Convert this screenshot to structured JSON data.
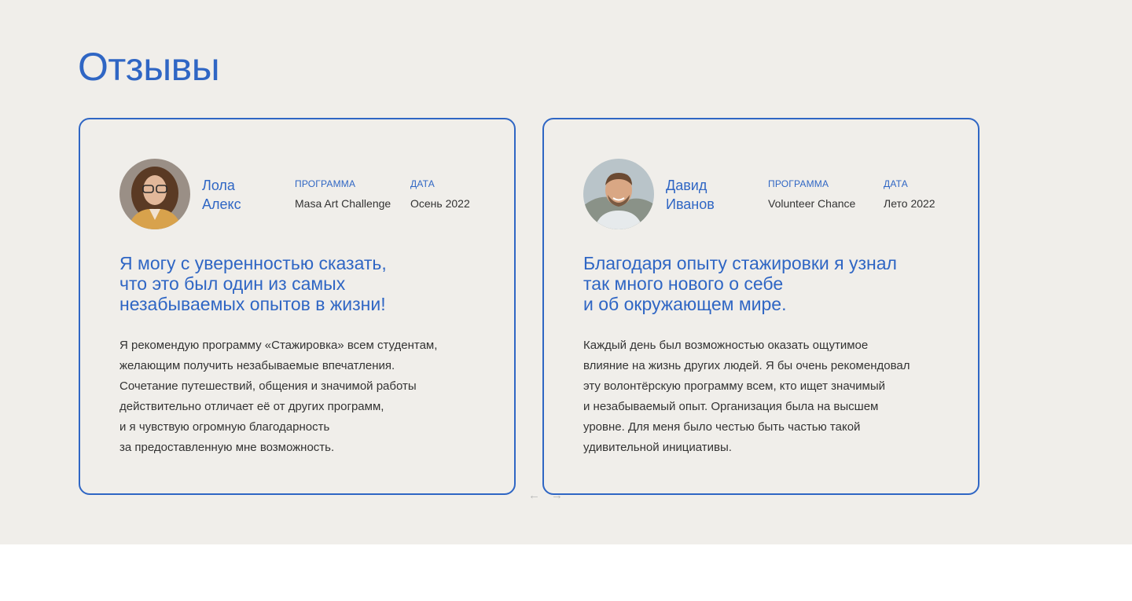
{
  "section": {
    "title": "Отзывы"
  },
  "labels": {
    "program": "ПРОГРАММА",
    "date": "ДАТА"
  },
  "reviews": [
    {
      "name": "Лола\nАлекс",
      "program": "Masa Art Challenge",
      "date": "Осень 2022",
      "quote": "Я могу с уверенностью сказать,\nчто это был один из самых\nнезабываемых опытов в жизни!",
      "text": "Я рекомендую программу «Стажировка» всем студентам,\nжелающим получить незабываемые впечатления.\nСочетание путешествий, общения и значимой работы\nдействительно отличает её от других программ,\nи я чувствую огромную благодарность\nза предоставленную мне возможность."
    },
    {
      "name": "Давид\nИванов",
      "program": "Volunteer Chance",
      "date": "Лето 2022",
      "quote": "Благодаря опыту стажировки я узнал\nтак много нового о себе\nи об окружающем мире.",
      "text": "Каждый день был возможностью оказать ощутимое\nвлияние на жизнь других людей. Я бы очень рекомендовал\nэту волонтёрскую программу всем, кто ищет значимый\nи незабываемый опыт. Организация была на высшем\nуровне. Для меня было честью быть частью такой\nудивительной инициативы."
    }
  ],
  "carousel": {
    "prev_icon": "←",
    "next_icon": "→"
  },
  "colors": {
    "accent": "#2f66c4",
    "background": "#f0eeea",
    "text": "#333333"
  }
}
